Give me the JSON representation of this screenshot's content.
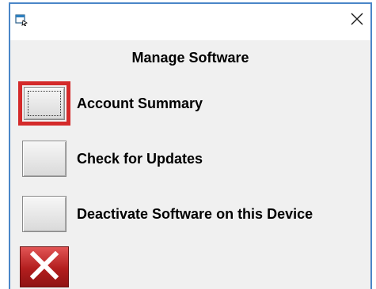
{
  "window": {
    "close_glyph": "×"
  },
  "dialog": {
    "title": "Manage Software"
  },
  "options": [
    {
      "label": "Account Summary",
      "selected": true
    },
    {
      "label": "Check for Updates",
      "selected": false
    },
    {
      "label": "Deactivate Software on this Device",
      "selected": false
    }
  ],
  "icons": {
    "app": "app-window-icon",
    "close": "close-icon",
    "cancel": "cancel-x-icon"
  },
  "colors": {
    "selection_border": "#d42a2a",
    "window_border": "#4a86c8",
    "cancel_red": "#b21e1e"
  }
}
